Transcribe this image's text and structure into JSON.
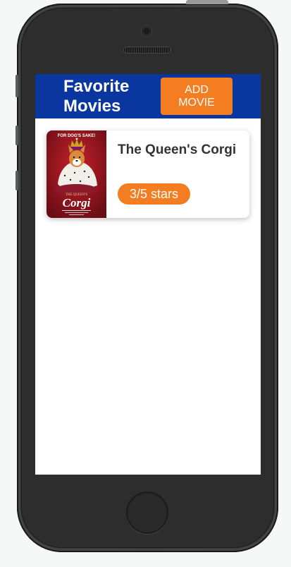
{
  "header": {
    "title": "Favorite Movies",
    "add_button_label": "ADD\nMOVIE"
  },
  "movies": [
    {
      "title": "The Queen's Corgi",
      "rating_label": "3/5 stars",
      "poster": {
        "tagline": "FOR DOG'S SAKE!",
        "title_small": "THE QUEEN'S",
        "title_large": "Corgi"
      }
    }
  ],
  "colors": {
    "header_bg": "#0a36a0",
    "accent": "#f47d21",
    "title_text": "#333333"
  }
}
